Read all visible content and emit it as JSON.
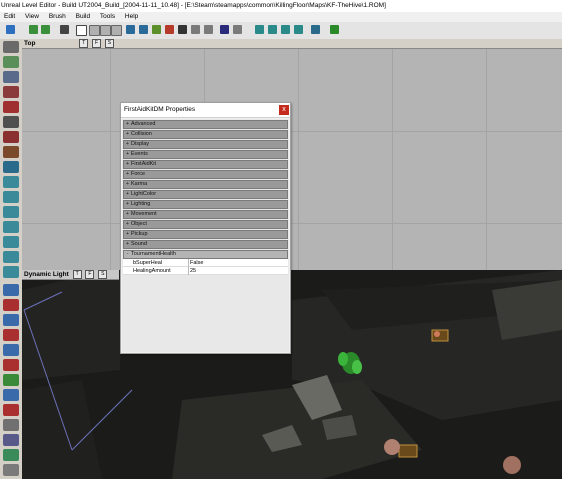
{
  "window": {
    "title": "Unreal Level Editor - Build UT2004_Build_[2004-11-11_10.48] - [E:\\Steam\\steamapps\\common\\KillingFloor\\Maps\\KF-TheHive\\1.ROM]"
  },
  "menu": [
    {
      "label": "Edit"
    },
    {
      "label": "View"
    },
    {
      "label": "Brush"
    },
    {
      "label": "Build"
    },
    {
      "label": "Tools"
    },
    {
      "label": "Help"
    }
  ],
  "viewports": {
    "top": {
      "label": "Top",
      "buttons": [
        "T",
        "F",
        "S"
      ]
    },
    "dynamic": {
      "label": "Dynamic Light",
      "buttons": [
        "T",
        "F",
        "S"
      ]
    }
  },
  "properties": {
    "title": "FirstAidKitDM Properties",
    "close_label": "x",
    "categories": [
      {
        "label": "Advanced",
        "sign": "+"
      },
      {
        "label": "Collision",
        "sign": "+"
      },
      {
        "label": "Display",
        "sign": "+"
      },
      {
        "label": "Events",
        "sign": "+"
      },
      {
        "label": "FirstAidKit",
        "sign": "+"
      },
      {
        "label": "Force",
        "sign": "+"
      },
      {
        "label": "Karma",
        "sign": "+"
      },
      {
        "label": "LightColor",
        "sign": "+"
      },
      {
        "label": "Lighting",
        "sign": "+"
      },
      {
        "label": "Movement",
        "sign": "+"
      },
      {
        "label": "Object",
        "sign": "+"
      },
      {
        "label": "Pickup",
        "sign": "+"
      },
      {
        "label": "Sound",
        "sign": "+"
      },
      {
        "label": "TournamentHealth",
        "sign": "-"
      }
    ],
    "fields": [
      {
        "name": "bSuperHeal",
        "value": "False"
      },
      {
        "name": "HealingAmount",
        "value": "25"
      }
    ]
  },
  "colors": {
    "accent": "#c42b1c",
    "viewport_bg": "#b4b4b4",
    "dark_viewport": "#1b1c1a",
    "category_bg": "#9a9a9a"
  }
}
